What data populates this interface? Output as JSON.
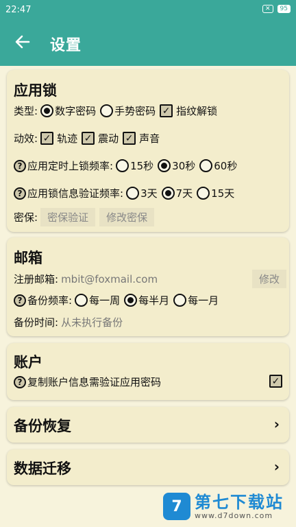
{
  "status": {
    "time": "22:47",
    "battery": "95",
    "close_box": "✕"
  },
  "header": {
    "title": "设置"
  },
  "applock": {
    "title": "应用锁",
    "type_label": "类型:",
    "type_options": [
      "数字密码",
      "手势密码"
    ],
    "type_checkbox": "指纹解锁",
    "anim_label": "动效:",
    "anim_options": [
      "轨迹",
      "震动",
      "声音"
    ],
    "timed_label": "应用定时上锁频率:",
    "timed_options": [
      "15秒",
      "30秒",
      "60秒"
    ],
    "verify_label": "应用锁信息验证频率:",
    "verify_options": [
      "3天",
      "7天",
      "15天"
    ],
    "secret_label": "密保:",
    "secret_verify": "密保验证",
    "secret_modify": "修改密保"
  },
  "mailbox": {
    "title": "邮箱",
    "reg_label": "注册邮箱:",
    "reg_value": "mbit@foxmail.com",
    "modify": "修改",
    "freq_label": "备份频率:",
    "freq_options": [
      "每一周",
      "每半月",
      "每一月"
    ],
    "time_label": "备份时间:",
    "time_value": "从未执行备份"
  },
  "account": {
    "title": "账户",
    "copy_label": "复制账户信息需验证应用密码"
  },
  "backup": {
    "title": "备份恢复"
  },
  "migrate": {
    "title": "数据迁移"
  },
  "watermark": {
    "logo": "7",
    "text": "第七下载站",
    "url": "www.d7down.com"
  }
}
